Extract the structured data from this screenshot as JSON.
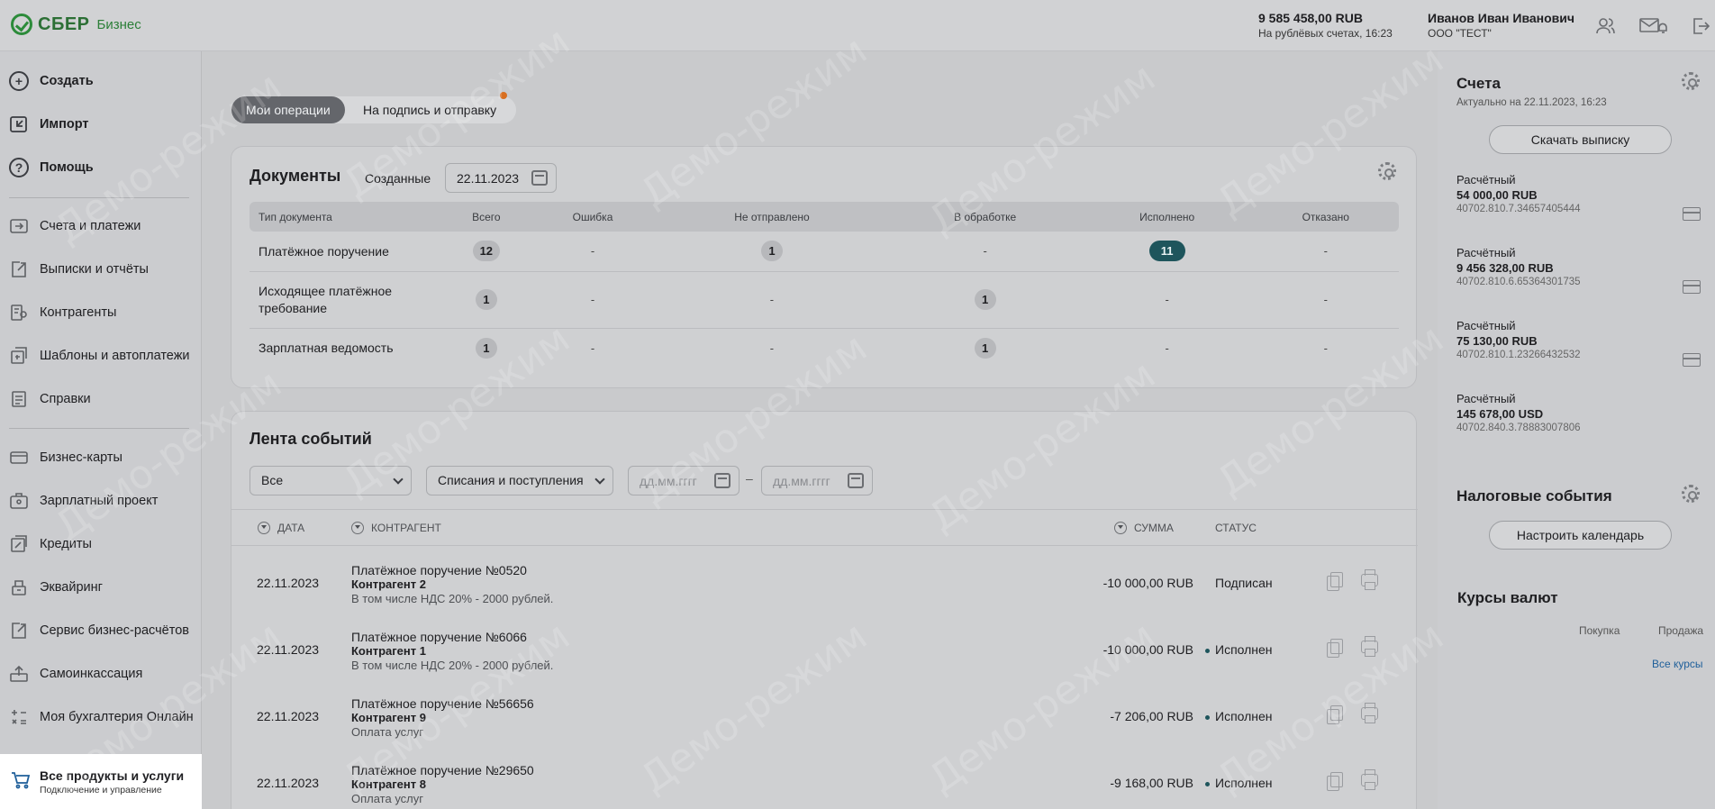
{
  "header": {
    "logo_text": "СБЕР",
    "logo_sub": "Бизнес",
    "balance": "9 585 458,00 RUB",
    "balance_note": "На рублёвых счетах, 16:23",
    "user_name": "Иванов Иван Иванович",
    "org_name": "ООО \"ТЕСТ\""
  },
  "sidebar": {
    "top_actions": [
      {
        "label": "Создать",
        "icon": "plus-icon"
      },
      {
        "label": "Импорт",
        "icon": "import-icon"
      },
      {
        "label": "Помощь",
        "icon": "help-icon"
      }
    ],
    "items": [
      {
        "label": "Счета и платежи",
        "icon": "accounts-icon"
      },
      {
        "label": "Выписки и отчёты",
        "icon": "statements-icon"
      },
      {
        "label": "Контрагенты",
        "icon": "contractors-icon"
      },
      {
        "label": "Шаблоны и автоплатежи",
        "icon": "templates-icon"
      },
      {
        "label": "Справки",
        "icon": "certificates-icon"
      },
      {
        "label": "Бизнес-карты",
        "icon": "card-icon"
      },
      {
        "label": "Зарплатный проект",
        "icon": "salary-icon"
      },
      {
        "label": "Кредиты",
        "icon": "credits-icon"
      },
      {
        "label": "Эквайринг",
        "icon": "acquiring-icon"
      },
      {
        "label": "Сервис бизнес-расчётов",
        "icon": "settlements-icon"
      },
      {
        "label": "Самоинкассация",
        "icon": "self-collection-icon"
      },
      {
        "label": "Моя бухгалтерия Онлайн",
        "icon": "accounting-icon"
      }
    ],
    "products": {
      "title": "Все продукты и услуги",
      "subtitle": "Подключение и управление"
    }
  },
  "tabs": {
    "active": "Мои операции",
    "second": "На подпись и отправку"
  },
  "documents": {
    "title": "Документы",
    "filter_label": "Созданные",
    "date": "22.11.2023",
    "columns": [
      "Тип документа",
      "Всего",
      "Ошибка",
      "Не отправлено",
      "В обработке",
      "Исполнено",
      "Отказано"
    ],
    "rows": [
      {
        "type": "Платёжное поручение",
        "total": "12",
        "error": "-",
        "not_sent": "1",
        "processing": "-",
        "done": "11",
        "rejected": "-"
      },
      {
        "type": "Исходящее платёжное требование",
        "total": "1",
        "error": "-",
        "not_sent": "-",
        "processing": "1",
        "done": "-",
        "rejected": "-"
      },
      {
        "type": "Зарплатная ведомость",
        "total": "1",
        "error": "-",
        "not_sent": "-",
        "processing": "1",
        "done": "-",
        "rejected": "-"
      }
    ]
  },
  "feed": {
    "title": "Лента событий",
    "filter1": "Все",
    "filter2": "Списания и поступления",
    "date_placeholder": "дд.мм.гггг",
    "dash": "–",
    "headers": {
      "date": "ДАТА",
      "counterparty": "КОНТРАГЕНТ",
      "sum": "СУММА",
      "status": "СТАТУС"
    },
    "rows": [
      {
        "date": "22.11.2023",
        "doc": "Платёжное поручение №0520",
        "party": "Контрагент 2",
        "note": "В том числе НДС 20% - 2000 рублей.",
        "sum": "-10 000,00 RUB",
        "status": "Подписан"
      },
      {
        "date": "22.11.2023",
        "doc": "Платёжное поручение №6066",
        "party": "Контрагент 1",
        "note": "В том числе НДС 20% - 2000 рублей.",
        "sum": "-10 000,00 RUB",
        "status": "Исполнен"
      },
      {
        "date": "22.11.2023",
        "doc": "Платёжное поручение №56656",
        "party": "Контрагент 9",
        "note": "Оплата услуг",
        "sum": "-7 206,00 RUB",
        "status": "Исполнен"
      },
      {
        "date": "22.11.2023",
        "doc": "Платёжное поручение №29650",
        "party": "Контрагент 8",
        "note": "Оплата услуг",
        "sum": "-9 168,00 RUB",
        "status": "Исполнен"
      }
    ]
  },
  "right_panel": {
    "accounts_title": "Счета",
    "accounts_updated": "Актуально на 22.11.2023, 16:23",
    "download_button": "Скачать выписку",
    "accounts": [
      {
        "type": "Расчётный",
        "amount": "54 000,00 RUB",
        "number": "40702.810.7.34657405444"
      },
      {
        "type": "Расчётный",
        "amount": "9 456 328,00 RUB",
        "number": "40702.810.6.65364301735"
      },
      {
        "type": "Расчётный",
        "amount": "75 130,00 RUB",
        "number": "40702.810.1.23266432532"
      },
      {
        "type": "Расчётный",
        "amount": "145 678,00 USD",
        "number": "40702.840.3.78883007806"
      }
    ],
    "tax_title": "Налоговые события",
    "calendar_button": "Настроить календарь",
    "rates_title": "Курсы валют",
    "rates_buy": "Покупка",
    "rates_sell": "Продажа",
    "all_rates": "Все курсы"
  },
  "watermark": "Демо-режим",
  "colors": {
    "accent_teal": "#1e555c",
    "brand_green": "#2c8b3a",
    "notification_orange": "#d86e20",
    "link_blue": "#1f5f9a"
  }
}
